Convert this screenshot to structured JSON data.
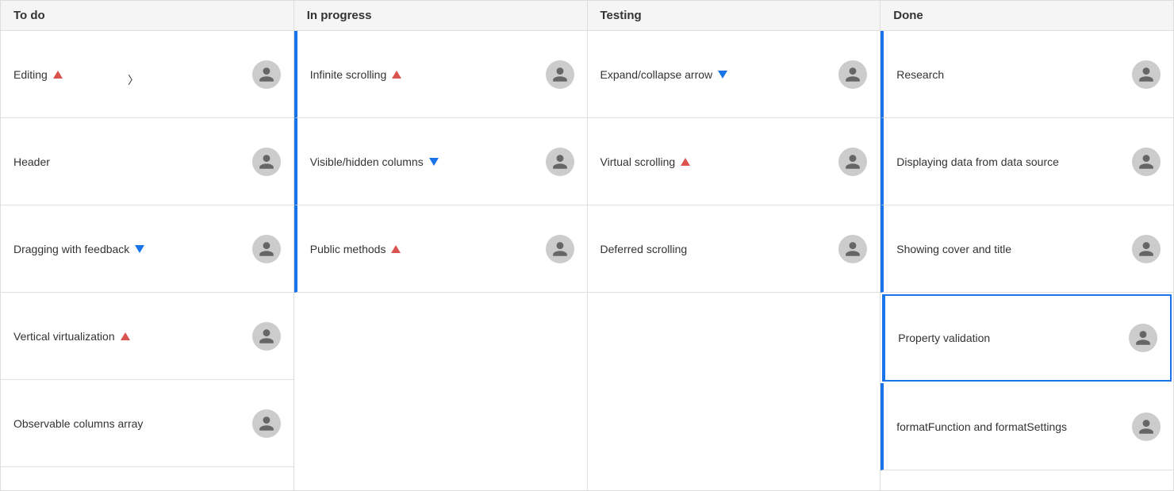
{
  "columns": [
    {
      "id": "todo",
      "label": "To do",
      "type": "default",
      "cards": [
        {
          "id": "editing",
          "title": "Editing",
          "badge": "up",
          "hasAvatar": true,
          "selected": false
        },
        {
          "id": "header",
          "title": "Header",
          "badge": null,
          "hasAvatar": true,
          "selected": false
        },
        {
          "id": "dragging",
          "title": "Dragging with feedback",
          "badge": "down",
          "hasAvatar": true,
          "selected": false
        },
        {
          "id": "vertical",
          "title": "Vertical virtualization",
          "badge": "up",
          "hasAvatar": true,
          "selected": false
        },
        {
          "id": "observable",
          "title": "Observable columns array",
          "badge": null,
          "hasAvatar": true,
          "selected": false
        }
      ]
    },
    {
      "id": "inprogress",
      "label": "In progress",
      "type": "in-progress",
      "cards": [
        {
          "id": "infinite",
          "title": "Infinite scrolling",
          "badge": "up",
          "hasAvatar": true,
          "selected": false
        },
        {
          "id": "visible",
          "title": "Visible/hidden columns",
          "badge": "down",
          "hasAvatar": true,
          "selected": false
        },
        {
          "id": "public",
          "title": "Public methods",
          "badge": "up",
          "hasAvatar": true,
          "selected": false
        }
      ]
    },
    {
      "id": "testing",
      "label": "Testing",
      "type": "default",
      "cards": [
        {
          "id": "expand",
          "title": "Expand/collapse arrow",
          "badge": "down",
          "hasAvatar": true,
          "selected": false
        },
        {
          "id": "virtual",
          "title": "Virtual scrolling",
          "badge": "up",
          "hasAvatar": true,
          "selected": false
        },
        {
          "id": "deferred",
          "title": "Deferred scrolling",
          "badge": null,
          "hasAvatar": true,
          "selected": false
        }
      ]
    },
    {
      "id": "done",
      "label": "Done",
      "type": "done",
      "cards": [
        {
          "id": "research",
          "title": "Research",
          "badge": null,
          "hasAvatar": true,
          "selected": false
        },
        {
          "id": "displaying",
          "title": "Displaying data from data source",
          "badge": null,
          "hasAvatar": true,
          "selected": false
        },
        {
          "id": "showing",
          "title": "Showing cover and title",
          "badge": null,
          "hasAvatar": true,
          "selected": false
        },
        {
          "id": "property",
          "title": "Property validation",
          "badge": null,
          "hasAvatar": true,
          "selected": true
        },
        {
          "id": "format",
          "title": "formatFunction and formatSettings",
          "badge": null,
          "hasAvatar": true,
          "selected": false
        }
      ]
    }
  ],
  "avatarLabel": "User avatar"
}
